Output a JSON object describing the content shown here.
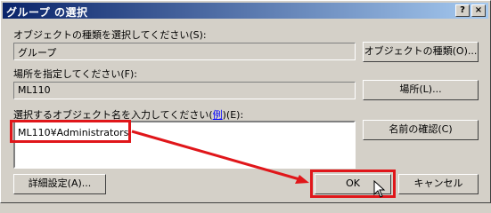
{
  "window": {
    "title": "グループ の選択",
    "help_label": "?",
    "close_label": "×"
  },
  "object_type": {
    "label": "オブジェクトの種類を選択してください(S):",
    "value": "グループ",
    "button_label": "オブジェクトの種類(O)..."
  },
  "location": {
    "label": "場所を指定してください(F):",
    "value": "ML110",
    "button_label": "場所(L)..."
  },
  "object_names": {
    "label_prefix": "選択するオブジェクト名を入力してください(",
    "example_link": "例",
    "label_suffix": ")(E):",
    "value": "ML110¥Administrators",
    "check_names_label": "名前の確認(C)"
  },
  "footer": {
    "advanced_label": "詳細設定(A)...",
    "ok_label": "OK",
    "cancel_label": "キャンセル"
  },
  "colors": {
    "titlebar_start": "#0a246a",
    "titlebar_end": "#a6caf0",
    "highlight": "#e0161a",
    "face": "#d4d0c8"
  }
}
